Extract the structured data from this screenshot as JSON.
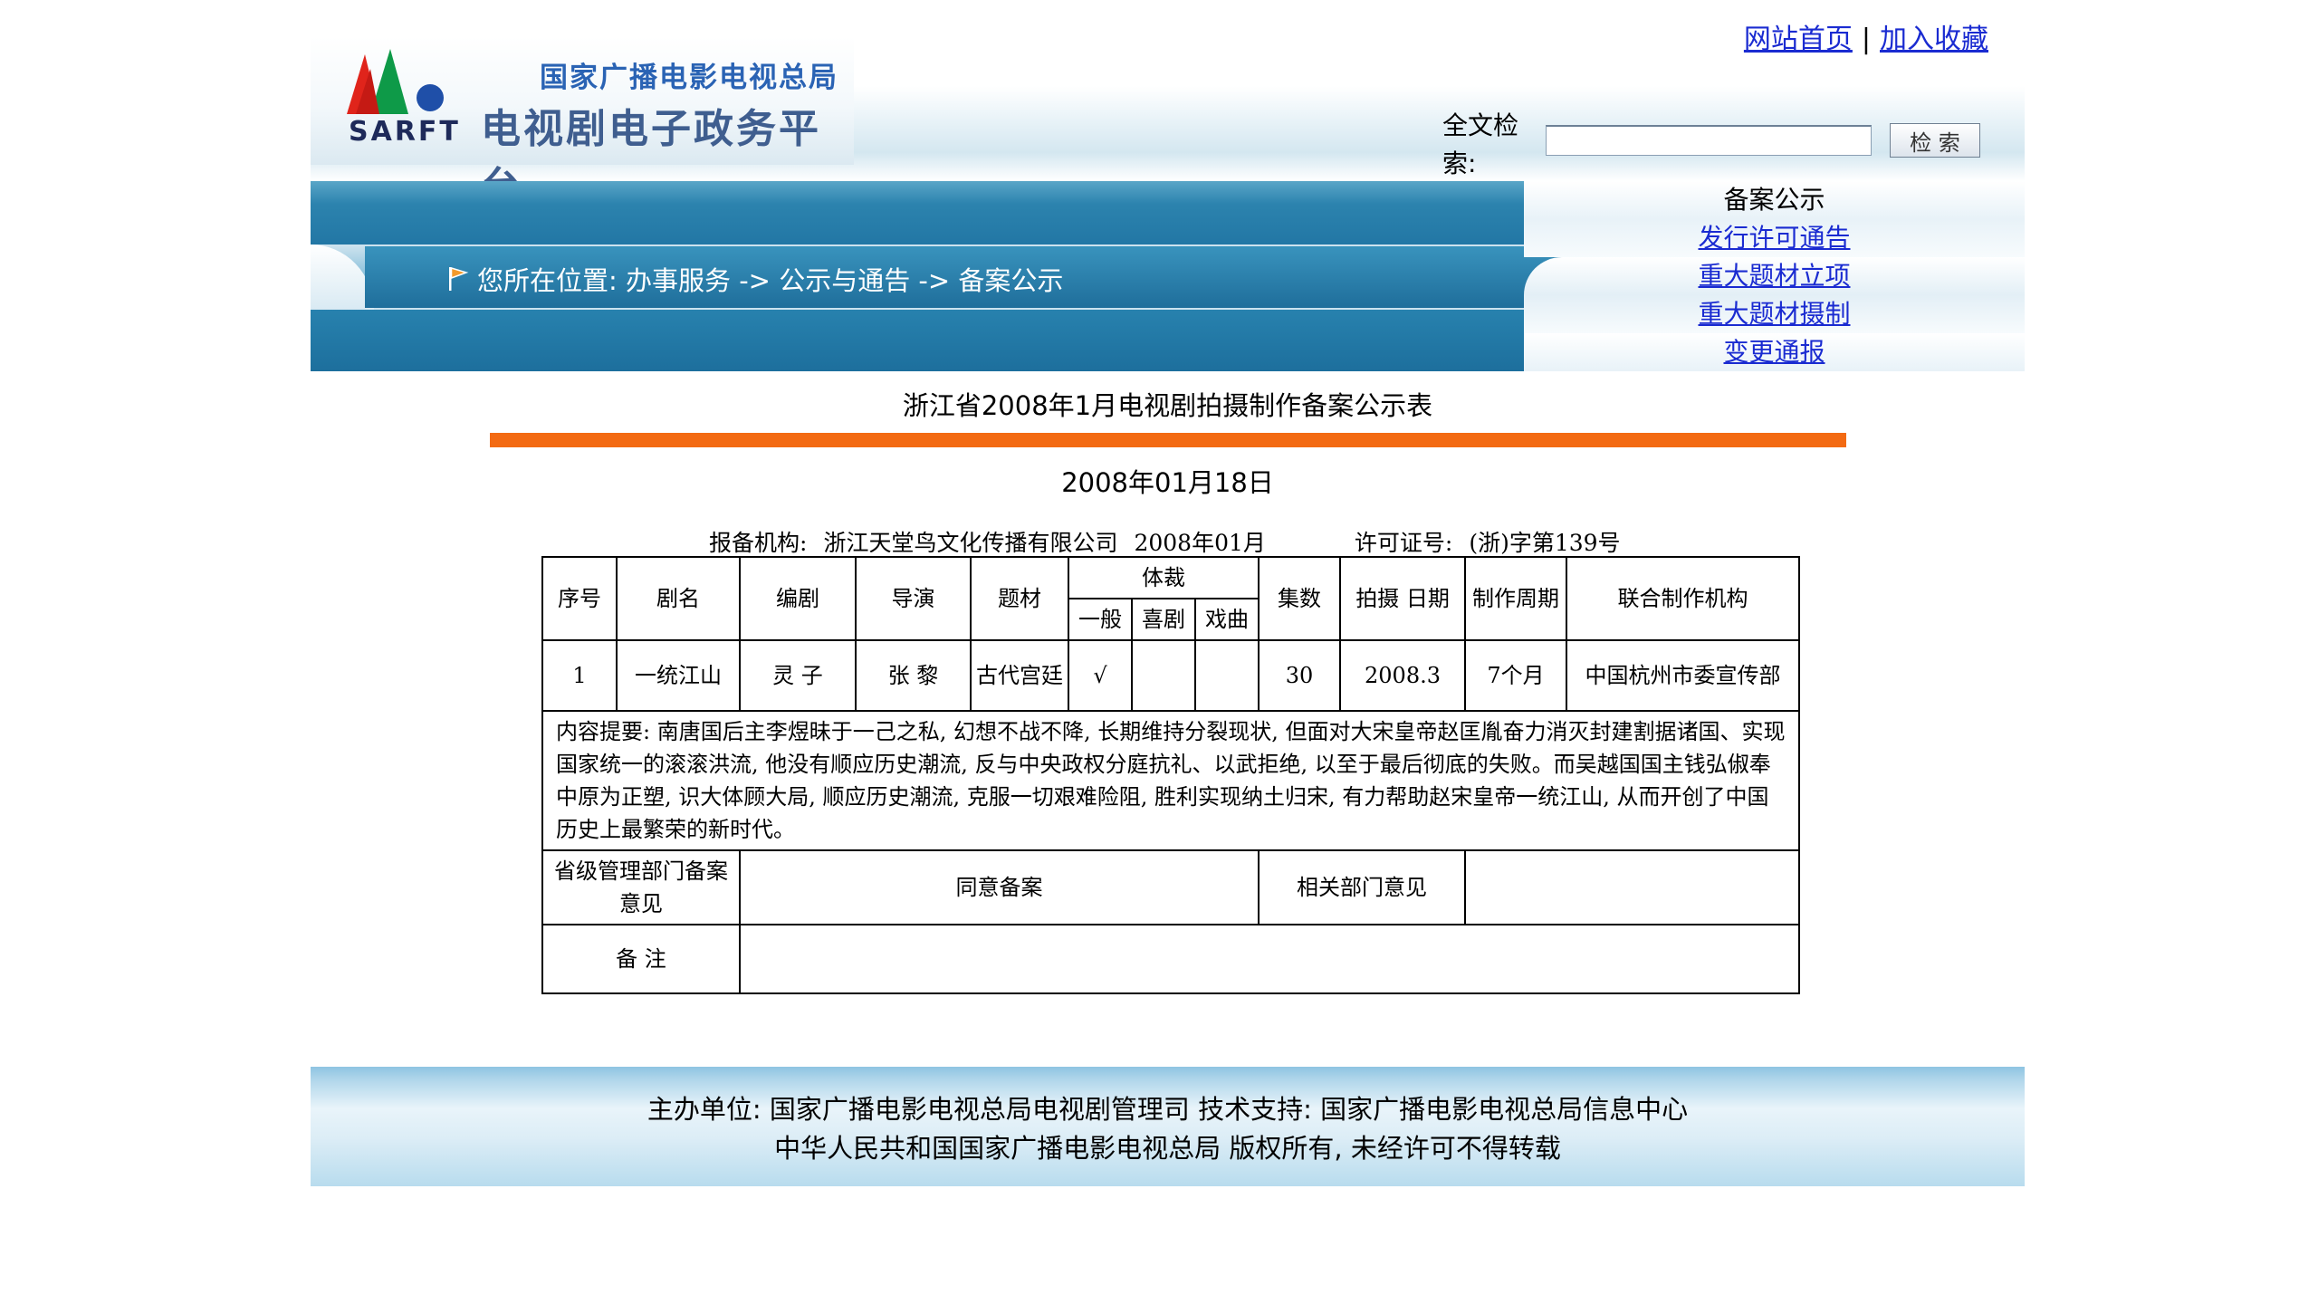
{
  "top_links": {
    "home": "网站首页",
    "separator": "|",
    "favorite": "加入收藏"
  },
  "logo": {
    "org_name": "国家广播电影电视总局",
    "platform_name": "电视剧电子政务平台",
    "abbr": "SARFT",
    "colors": [
      "#e0241b",
      "#0e9a48",
      "#1f4fa8"
    ]
  },
  "search": {
    "label": "全文检索:",
    "value": "",
    "button": "检 索"
  },
  "breadcrumb": "您所在位置: 办事服务 -> 公示与通告 -> 备案公示",
  "side_menu": {
    "current": "备案公示",
    "links": [
      "发行许可通告",
      "重大题材立项",
      "重大题材摄制",
      "变更通报"
    ]
  },
  "document": {
    "title": "浙江省2008年1月电视剧拍摄制作备案公示表",
    "date": "2008年01月18日",
    "meta": {
      "org_label": "报备机构:",
      "org": "浙江天堂鸟文化传播有限公司",
      "month": "2008年01月",
      "license_label": "许可证号:",
      "license": "(浙)字第139号"
    },
    "table": {
      "headers": {
        "seq": "序号",
        "name": "剧名",
        "writer": "编剧",
        "director": "导演",
        "theme": "题材",
        "genre": "体裁",
        "genre_general": "一般",
        "genre_comedy": "喜剧",
        "genre_opera": "戏曲",
        "episodes": "集数",
        "shoot_date": "拍摄 日期",
        "period": "制作周期",
        "co_producer": "联合制作机构"
      },
      "row": {
        "seq": "1",
        "name": "一统江山",
        "writer": "灵 子",
        "director": "张 黎",
        "theme": "古代宫廷",
        "genre_general": "√",
        "genre_comedy": "",
        "genre_opera": "",
        "episodes": "30",
        "shoot_date": "2008.3",
        "period": "7个月",
        "co_producer": "中国杭州市委宣传部"
      },
      "summary": "内容提要: 南唐国后主李煜昧于一己之私, 幻想不战不降, 长期维持分裂现状, 但面对大宋皇帝赵匡胤奋力消灭封建割据诸国、实现国家统一的滚滚洪流, 他没有顺应历史潮流, 反与中央政权分庭抗礼、以武拒绝, 以至于最后彻底的失败。而吴越国国主钱弘俶奉中原为正塑, 识大体顾大局, 顺应历史潮流, 克服一切艰难险阻, 胜利实现纳土归宋, 有力帮助赵宋皇帝一统江山, 从而开创了中国历史上最繁荣的新时代。",
      "opinion_label": "省级管理部门备案意见",
      "opinion_value": "同意备案",
      "related_label": "相关部门意见",
      "related_value": "",
      "remark_label": "备 注",
      "remark_value": ""
    }
  },
  "footer": {
    "line1": "主办单位: 国家广播电影电视总局电视剧管理司 技术支持: 国家广播电影电视总局信息中心",
    "line2": "中华人民共和国国家广播电影电视总局 版权所有, 未经许可不得转载"
  }
}
